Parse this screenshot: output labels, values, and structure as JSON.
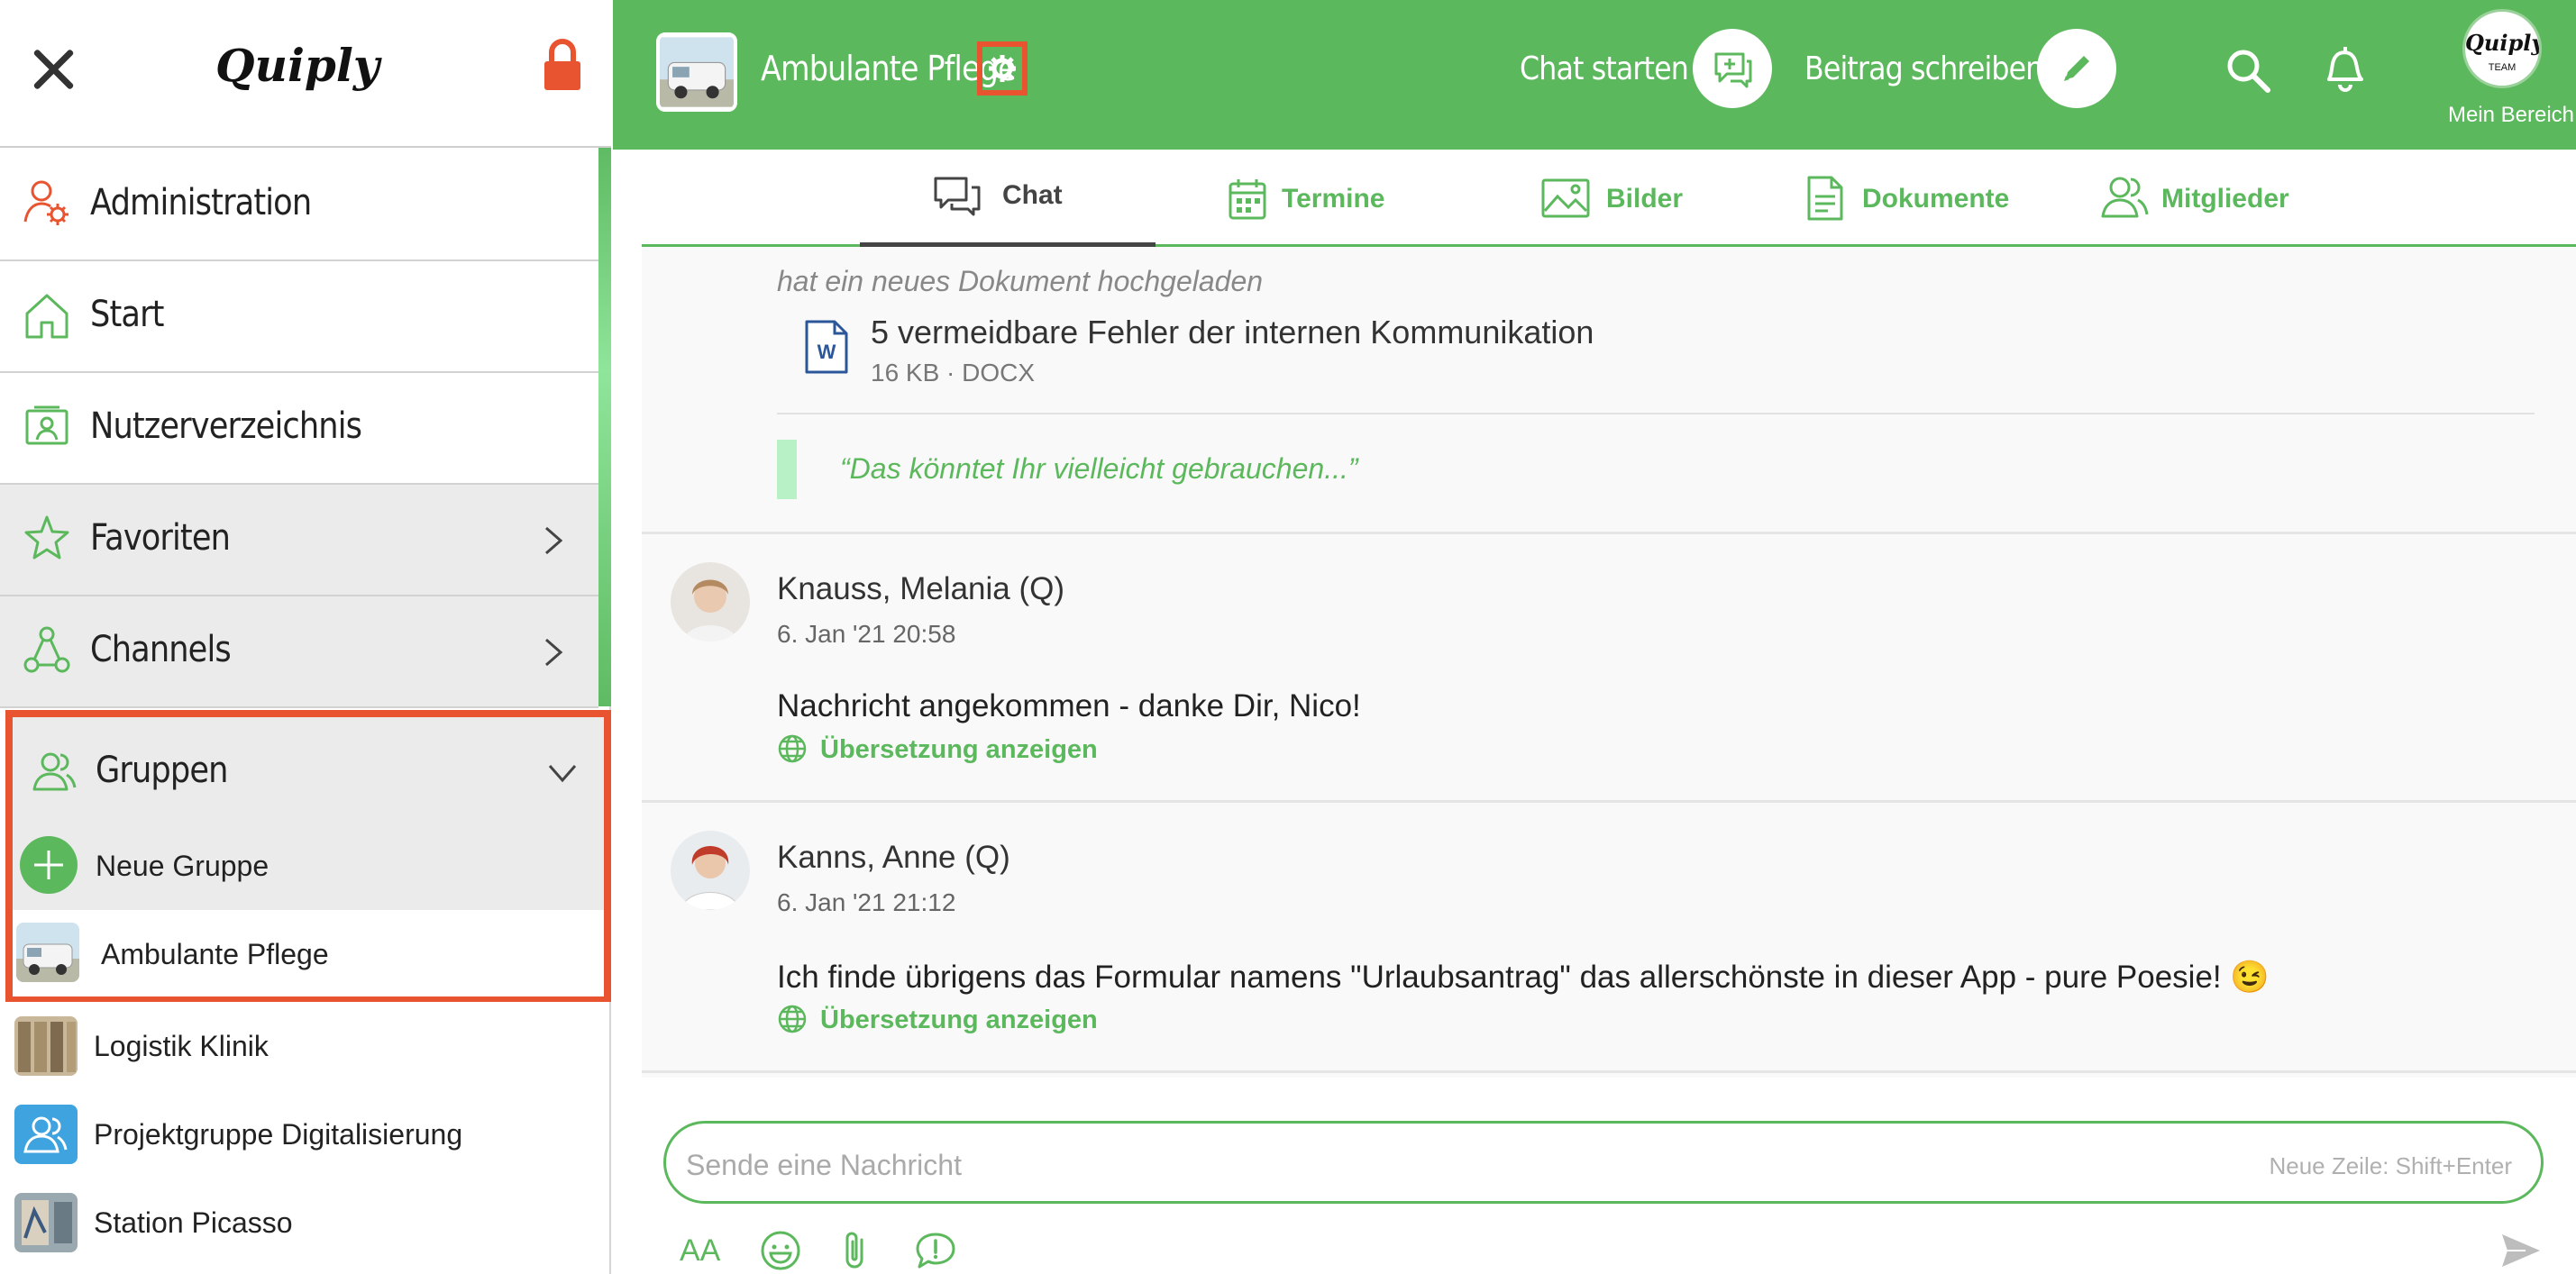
{
  "sidebar": {
    "logo": "Quiply",
    "nav": [
      {
        "label": "Administration",
        "icon": "admin-user-gear-icon"
      },
      {
        "label": "Start",
        "icon": "home-icon"
      },
      {
        "label": "Nutzerverzeichnis",
        "icon": "user-directory-icon"
      },
      {
        "label": "Favoriten",
        "icon": "star-icon"
      },
      {
        "label": "Channels",
        "icon": "channels-icon"
      },
      {
        "label": "Gruppen",
        "icon": "groups-icon"
      }
    ],
    "groups": [
      {
        "label": "Neue Gruppe",
        "icon": "plus-circle-icon"
      },
      {
        "label": "Ambulante Pflege",
        "icon": "group-thumbnail"
      },
      {
        "label": "Logistik Klinik",
        "icon": "group-thumbnail"
      },
      {
        "label": "Projektgruppe Digitalisierung",
        "icon": "group-people-icon"
      },
      {
        "label": "Station Picasso",
        "icon": "group-thumbnail"
      }
    ]
  },
  "header": {
    "group_title": "Ambulante Pflege",
    "chat_start_label": "Chat starten",
    "write_post_label": "Beitrag schreiben",
    "avatar_text": "Quiply",
    "avatar_sub": "TEAM",
    "my_area_label": "Mein Bereich"
  },
  "tabs": [
    {
      "label": "Chat",
      "icon": "chat-bubbles-icon",
      "active": true
    },
    {
      "label": "Termine",
      "icon": "calendar-icon"
    },
    {
      "label": "Bilder",
      "icon": "image-icon"
    },
    {
      "label": "Dokumente",
      "icon": "document-icon"
    },
    {
      "label": "Mitglieder",
      "icon": "members-icon"
    }
  ],
  "feed": {
    "doc_note": "hat ein neues Dokument hochgeladen",
    "doc_title": "5 vermeidbare Fehler der internen Kommunikation",
    "doc_meta": "16 KB · DOCX",
    "doc_icon_letter": "W",
    "quote": "“Das könntet Ihr vielleicht gebrauchen...”",
    "posts": [
      {
        "author": "Knauss, Melania (Q)",
        "date": "6. Jan '21 20:58",
        "text": "Nachricht angekommen - danke Dir, Nico!",
        "translate": "Übersetzung anzeigen"
      },
      {
        "author": "Kanns, Anne (Q)",
        "date": "6. Jan '21 21:12",
        "text": "Ich finde übrigens das Formular namens \"Urlaubsantrag\" das allerschönste in dieser App - pure Poesie! 😉",
        "translate": "Übersetzung anzeigen"
      }
    ]
  },
  "composer": {
    "placeholder": "Sende eine Nachricht",
    "hint": "Neue Zeile: Shift+Enter",
    "font_size_label": "AA"
  },
  "colors": {
    "brand_green": "#5cb85c",
    "highlight_red": "#e8542f",
    "lock_red": "#e8542f"
  }
}
